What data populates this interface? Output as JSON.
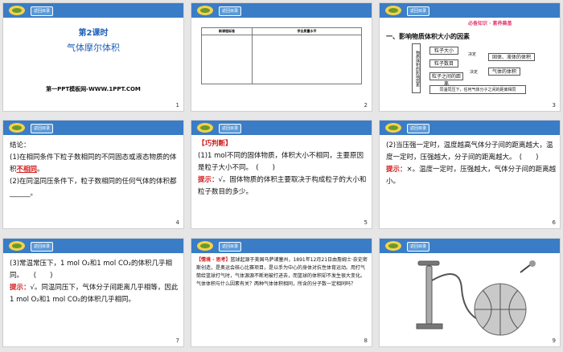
{
  "common": {
    "back_label": "返回目录"
  },
  "slides": [
    {
      "num": "1",
      "title": "第2课时",
      "subtitle": "气体摩尔体积",
      "footer": "第一PPT模板网-WWW.1PPT.COM"
    },
    {
      "num": "2",
      "table_head": [
        "新课程标准",
        "学业质量水平"
      ]
    },
    {
      "num": "3",
      "banner": "必备知识 · 素养奠基",
      "heading": "一、影响物质体积大小的因素",
      "diagram": {
        "root": "物质体积的影响因素",
        "n1": "粒子大小",
        "n2": "粒子数目",
        "n3": "粒子之间的距离",
        "d1": "决定",
        "d2": "决定",
        "r1": "固体、液体的体积",
        "r2": "气体的体积",
        "bottom": "同温同压下，任何气体分子之间的距离相同"
      }
    },
    {
      "num": "4",
      "intro": "结论：",
      "p1a": "(1)在相同条件下粒子数相同的不同固态或液态物质的体积",
      "p1ans": "不相同",
      "p1b": "。",
      "p2a": "(2)在同温同压条件下，粒子数相同的任何气体的体积都",
      "p2b": "______。"
    },
    {
      "num": "5",
      "tag": "【巧判断】",
      "q": "(1)1 mol不同的固体物质，体积大小不相同，主要原因是粒子大小不同。　(　　)",
      "hint_label": "提示：",
      "hint": "√。固体物质的体积主要取决于构成粒子的大小和粒子数目的多少。"
    },
    {
      "num": "6",
      "q": "(2)当压强一定时，温度越高气体分子间的距离越大，温度一定时，压强越大，分子间的距离越大。　(　　)",
      "hint_label": "提示：",
      "hint": "×。温度一定时，压强越大，气体分子间的距离越小。"
    },
    {
      "num": "7",
      "q": "(3)常温常压下，1 mol O₂和1 mol CO₂的体积几乎相同。　　(　　)",
      "hint_label": "提示：",
      "hint": "√。同温同压下，气体分子间距离几乎相等，因此1 mol O₂和1 mol CO₂的体积几乎相同。"
    },
    {
      "num": "8",
      "tag": "【情境 · 思考】",
      "body": "篮球起源于美国马萨诸塞州，1891年12月21日由詹姆士·奈史密斯创造，是奥运会核心比赛项目，是以手为中心的身体对抗性体育运动。用打气筒给篮球打气时，气体源源不断地被打进去，而篮球的体积却不发生很大变化。",
      "question": "气体体积与什么因素有关？两种气体体积相同，所含的分子数一定相同吗？"
    },
    {
      "num": "9"
    }
  ]
}
